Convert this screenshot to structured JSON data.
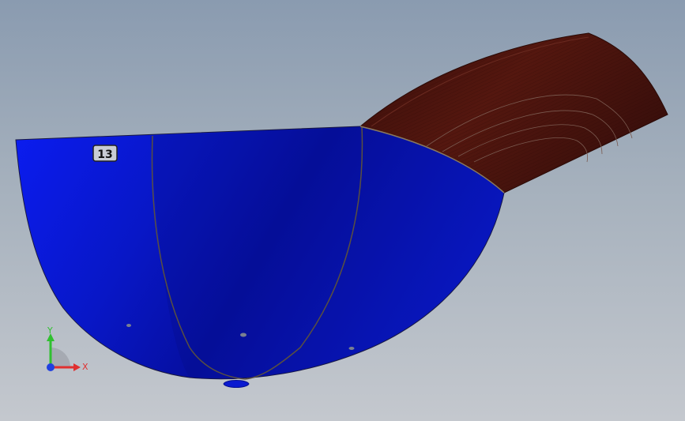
{
  "viewport": {
    "background_top": "#8a9bb0",
    "background_bottom": "#c4c8ce"
  },
  "model": {
    "crown_color": "#0a14c8",
    "crown_dark": "#040c8a",
    "visor_color": "#4a1410",
    "seam_color": "#5a5040",
    "size_label_text": "13",
    "size_label_icon": "size-tag-icon"
  },
  "triad": {
    "x_label": "X",
    "y_label": "Y",
    "x_color": "#e03030",
    "y_color": "#30c030",
    "z_color": "#2040e0"
  }
}
